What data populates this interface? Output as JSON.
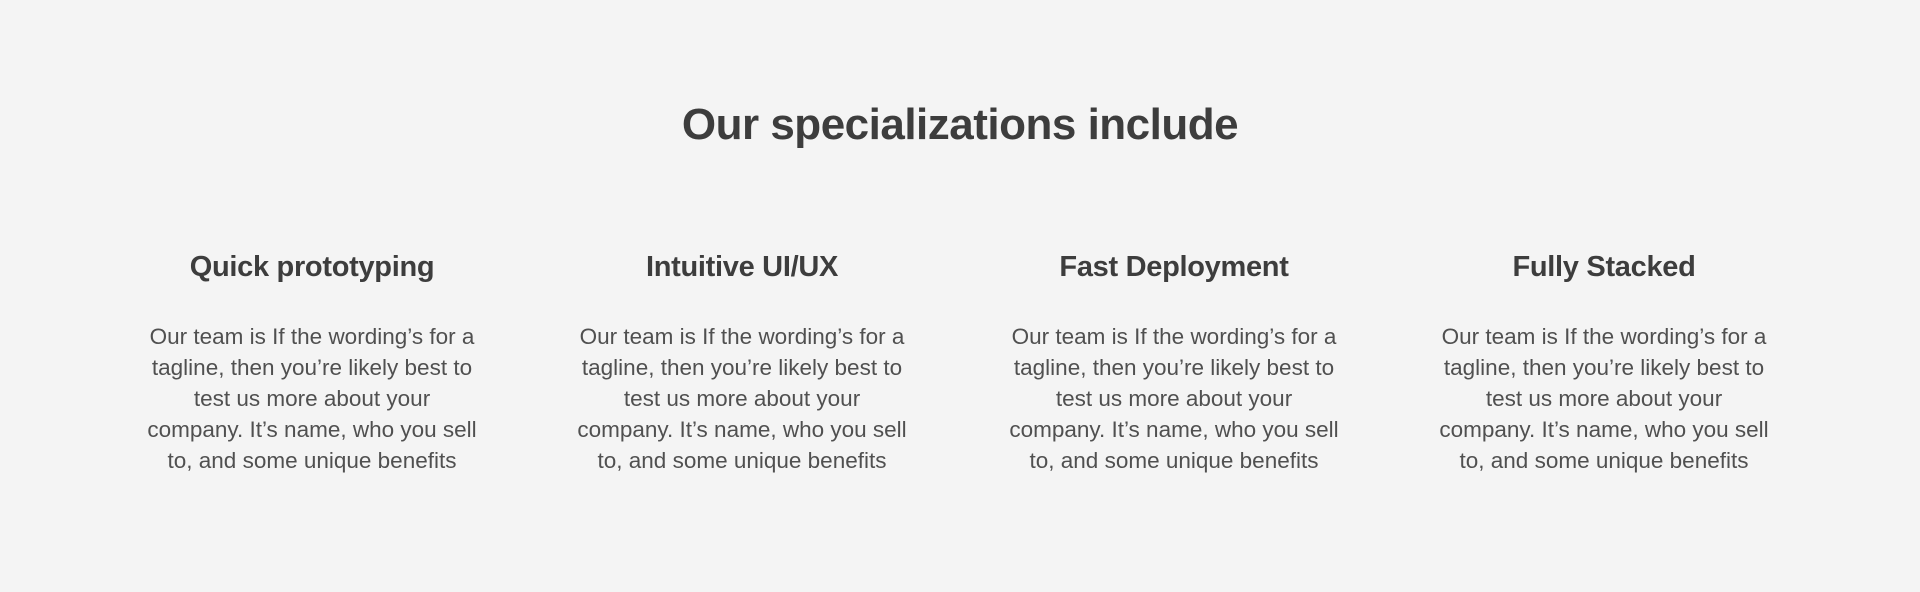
{
  "section": {
    "title": "Our specializations include",
    "items": [
      {
        "heading": "Quick prototyping",
        "lines": [
          "Our team is If the wording’s for a",
          "tagline, then you’re likely best to",
          "test us more about your",
          "company. It’s name, who you sell",
          "to, and some unique benefits"
        ]
      },
      {
        "heading": "Intuitive UI/UX",
        "lines": [
          "Our team is If the wording’s for a",
          "tagline, then you’re likely best to",
          "test us more about your",
          "company. It’s name, who you sell",
          "to, and some unique benefits"
        ]
      },
      {
        "heading": "Fast Deployment",
        "lines": [
          "Our team is If the wording’s for a",
          "tagline, then you’re likely best to",
          "test us more about your",
          "company. It’s name, who you sell",
          "to, and some unique benefits"
        ]
      },
      {
        "heading": "Fully Stacked",
        "lines": [
          "Our team is If the wording’s for a",
          "tagline, then you’re likely best to",
          "test us more about your",
          "company. It’s name, who you sell",
          "to, and some unique benefits"
        ]
      }
    ]
  }
}
